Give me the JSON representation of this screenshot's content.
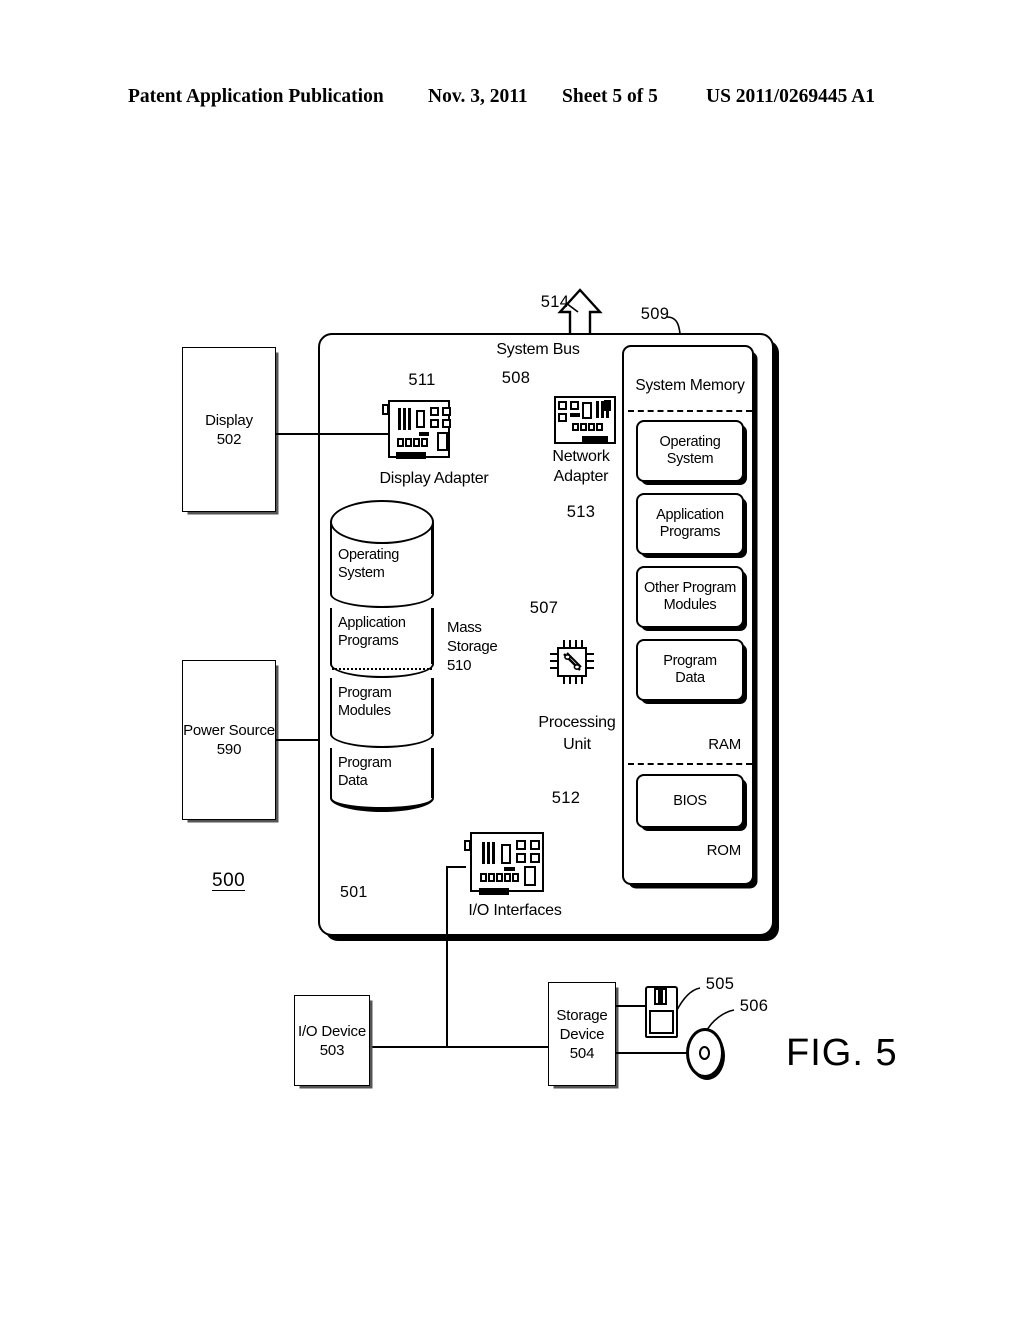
{
  "header": {
    "publication": "Patent Application Publication",
    "date": "Nov. 3, 2011",
    "sheet": "Sheet 5 of 5",
    "number": "US 2011/0269445 A1"
  },
  "figure": {
    "label": "FIG. 5",
    "system_ref": "500",
    "computer_ref": "501"
  },
  "boxes": {
    "display": {
      "label": "Display",
      "ref": "502"
    },
    "power_source": {
      "label": "Power Source",
      "ref": "590"
    },
    "io_device": {
      "label": "I/O Device",
      "ref": "503"
    },
    "storage_device": {
      "label": "Storage",
      "label2": "Device",
      "ref": "504"
    }
  },
  "bus": {
    "label": "System Bus",
    "ref": "508",
    "network_out_ref": "514"
  },
  "adapters": {
    "display_adapter": {
      "label": "Display Adapter",
      "ref": "511"
    },
    "network_adapter": {
      "label": "Network",
      "label2": "Adapter",
      "ref": "513"
    },
    "io_interfaces": {
      "label": "I/O Interfaces",
      "ref": "512"
    },
    "processing_unit": {
      "label": "Processing",
      "label2": "Unit",
      "ref": "507"
    }
  },
  "mass_storage": {
    "label": "Mass",
    "label2": "Storage",
    "ref": "510",
    "segments": [
      {
        "line1": "Operating",
        "line2": "System"
      },
      {
        "line1": "Application",
        "line2": "Programs"
      },
      {
        "line1": "Program",
        "line2": "Modules"
      },
      {
        "line1": "Program",
        "line2": "Data"
      }
    ]
  },
  "system_memory": {
    "title": "System Memory",
    "ref": "509",
    "ram_tag": "RAM",
    "rom_tag": "ROM",
    "ram_cells": [
      {
        "line1": "Operating",
        "line2": "System"
      },
      {
        "line1": "Application",
        "line2": "Programs"
      },
      {
        "line1": "Other Program",
        "line2": "Modules"
      },
      {
        "line1": "Program",
        "line2": "Data"
      }
    ],
    "rom_cells": [
      {
        "line1": "BIOS",
        "line2": ""
      }
    ]
  },
  "media": {
    "floppy_ref": "505",
    "disc_ref": "506"
  },
  "colors": {
    "ink": "#000000",
    "paper": "#ffffff"
  }
}
